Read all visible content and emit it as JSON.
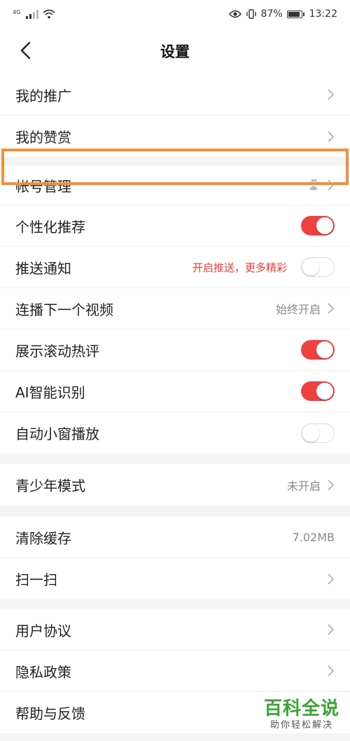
{
  "status_bar": {
    "network": "4G",
    "battery_percent": "87%",
    "time": "13:22"
  },
  "header": {
    "title": "设置"
  },
  "groups": [
    {
      "rows": [
        {
          "label": "我的推广"
        },
        {
          "label": "我的赞赏"
        }
      ]
    },
    {
      "rows": [
        {
          "label": "帐号管理"
        }
      ]
    },
    {
      "rows": [
        {
          "label": "个性化推荐",
          "toggle": true
        },
        {
          "label": "推送通知",
          "hint": "开启推送，更多精彩",
          "toggle": false
        },
        {
          "label": "连播下一个视频",
          "value": "始终开启"
        },
        {
          "label": "展示滚动热评",
          "toggle": true
        },
        {
          "label": "AI智能识别",
          "toggle": true
        },
        {
          "label": "自动小窗播放",
          "toggle": false
        }
      ]
    },
    {
      "rows": [
        {
          "label": "青少年模式",
          "value": "未开启"
        }
      ]
    },
    {
      "rows": [
        {
          "label": "清除缓存",
          "value": "7.02MB"
        },
        {
          "label": "扫一扫"
        }
      ]
    },
    {
      "rows": [
        {
          "label": "用户协议"
        },
        {
          "label": "隐私政策"
        },
        {
          "label": "帮助与反馈"
        }
      ]
    }
  ],
  "colors": {
    "accent_red": "#f04040",
    "highlight_orange": "#f0903a",
    "watermark_green": "#3aa335"
  },
  "watermark": {
    "title": "百科全说",
    "subtitle": "助你轻松解决"
  }
}
